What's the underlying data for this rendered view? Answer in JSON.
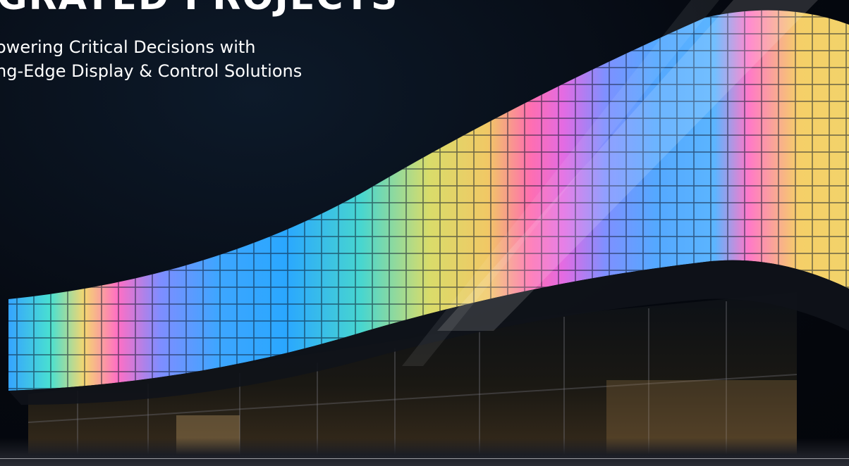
{
  "hero": {
    "headline": "GRATED PROJECTS",
    "subtitle_line1": "owering Critical Decisions with",
    "subtitle_line2": "ng-Edge Display & Control Solutions"
  },
  "colors": {
    "background": "#05080f",
    "text": "#ffffff",
    "facade_palette": [
      "#3aa0ff",
      "#3fd9c8",
      "#f2d36a",
      "#f06fc0",
      "#5a8cff",
      "#9a8cff"
    ]
  }
}
